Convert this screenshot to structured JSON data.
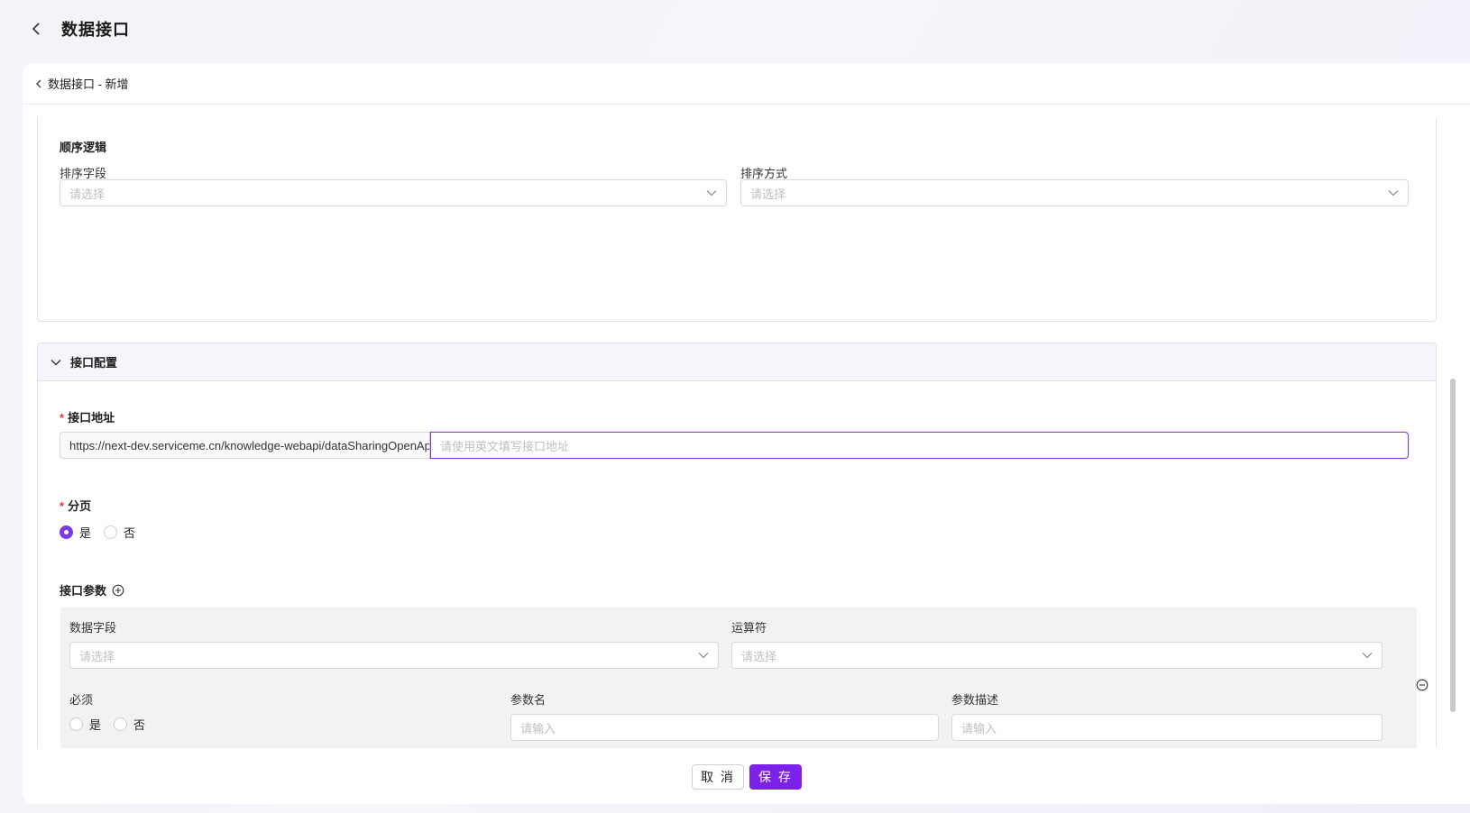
{
  "header": {
    "title": "数据接口"
  },
  "breadcrumb": {
    "label": "数据接口 - 新增"
  },
  "sort_section": {
    "title": "顺序逻辑",
    "field_label": "排序字段",
    "field_placeholder": "请选择",
    "order_label": "排序方式",
    "order_placeholder": "请选择"
  },
  "interface_config": {
    "title": "接口配置",
    "address_label": "接口地址",
    "address_prefix": "https://next-dev.serviceme.cn/knowledge-webapi/dataSharingOpenApi",
    "address_placeholder": "请使用英文填写接口地址",
    "paging_label": "分页",
    "paging_yes": "是",
    "paging_no": "否",
    "paging_selected": "是",
    "params_label": "接口参数",
    "param_row": {
      "data_field_label": "数据字段",
      "data_field_placeholder": "请选择",
      "operator_label": "运算符",
      "operator_placeholder": "请选择",
      "required_label": "必须",
      "required_yes": "是",
      "required_no": "否",
      "param_name_label": "参数名",
      "param_name_placeholder": "请输入",
      "param_desc_label": "参数描述",
      "param_desc_placeholder": "请输入"
    }
  },
  "footer": {
    "cancel_label": "取 消",
    "save_label": "保 存"
  },
  "colors": {
    "accent": "#7c22e8",
    "required": "#e53935"
  }
}
